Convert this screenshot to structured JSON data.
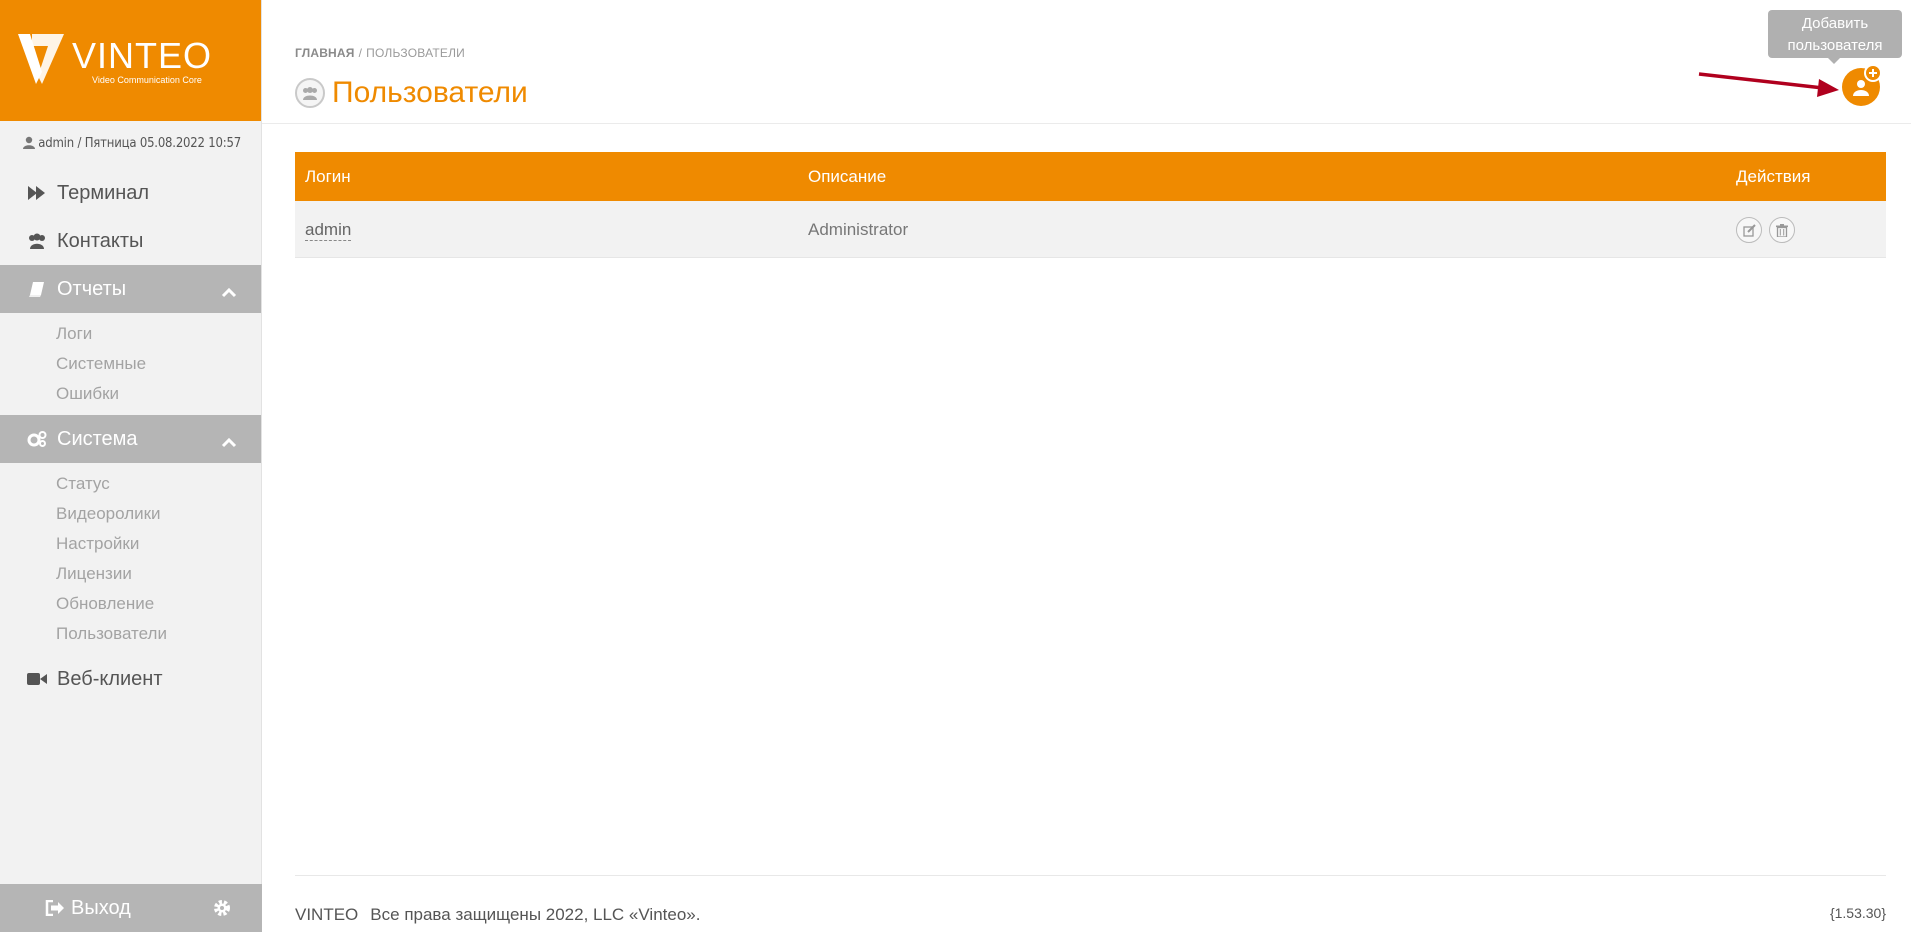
{
  "logo": {
    "brand": "VINTEO",
    "tagline": "Video Communication Core"
  },
  "user_info": "admin / Пятница 05.08.2022 10:57",
  "nav": {
    "terminal": "Терминал",
    "contacts": "Контакты",
    "reports": {
      "label": "Отчеты",
      "items": [
        "Логи",
        "Системные",
        "Ошибки"
      ]
    },
    "system": {
      "label": "Система",
      "items": [
        "Статус",
        "Видеоролики",
        "Настройки",
        "Лицензии",
        "Обновление",
        "Пользователи"
      ]
    },
    "web_client": "Веб-клиент"
  },
  "logout_label": "Выход",
  "breadcrumb": {
    "home": "ГЛАВНАЯ",
    "separator": "/",
    "current": "ПОЛЬЗОВАТЕЛИ"
  },
  "page_title": "Пользователи",
  "tooltip": {
    "line1": "Добавить",
    "line2": "пользователя"
  },
  "table": {
    "headers": {
      "login": "Логин",
      "description": "Описание",
      "actions": "Действия"
    },
    "rows": [
      {
        "login": "admin",
        "description": "Administrator",
        "actions": [
          "edit-icon",
          "trash-icon"
        ]
      }
    ]
  },
  "footer": {
    "brand": "VINTEO",
    "copyright": "Все права защищены 2022, LLC «Vinteo».",
    "version": "{1.53.30}"
  },
  "colors": {
    "accent": "#ef8a00",
    "section_bg": "#b5b5b5",
    "sidebar_bg": "#f2f2f2",
    "annotation_arrow": "#b0001e"
  }
}
